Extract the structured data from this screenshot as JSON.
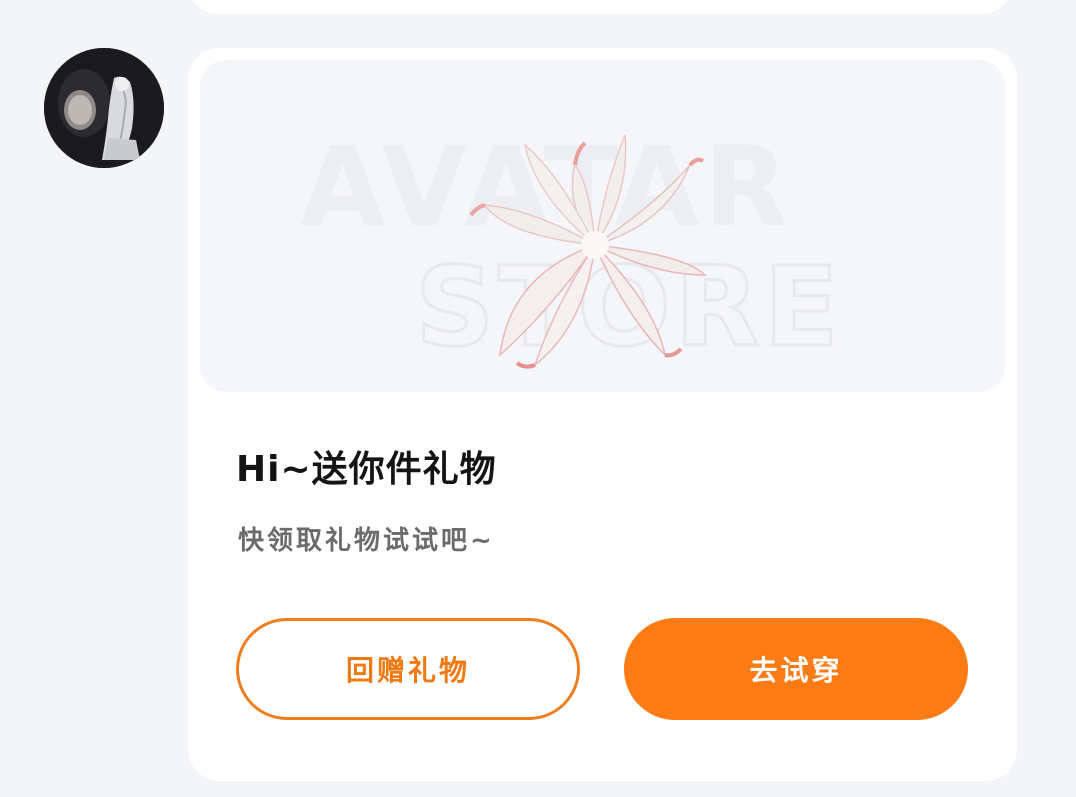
{
  "message": {
    "sender_avatar": "avatar-image",
    "card": {
      "banner": {
        "watermark_line1": "AVATAR",
        "watermark_line2": "STORE",
        "image": "fox-tail-gift-image"
      },
      "title": "Hi~送你件礼物",
      "subtitle": "快领取礼物试试吧~",
      "buttons": {
        "return_gift": "回赠礼物",
        "try_on": "去试穿"
      }
    }
  },
  "colors": {
    "accent": "#fc7b14",
    "page_background": "#f4f5f8",
    "card_background": "#ffffff",
    "title_text": "#141414",
    "subtitle_text": "#6b6b6b"
  }
}
